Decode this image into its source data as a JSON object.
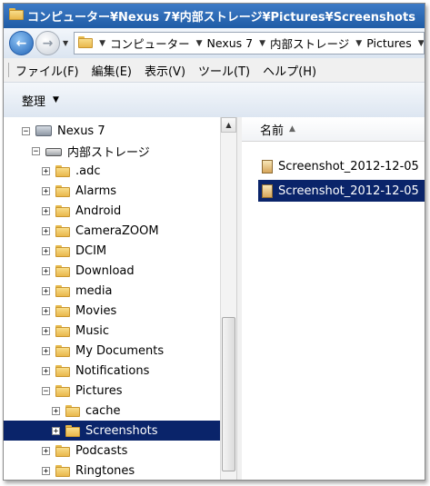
{
  "window": {
    "title": "コンピューター¥Nexus 7¥内部ストレージ¥Pictures¥Screenshots"
  },
  "address": {
    "segments": [
      "コンピューター",
      "Nexus 7",
      "内部ストレージ",
      "Pictures"
    ]
  },
  "menu": {
    "items": [
      "ファイル(F)",
      "編集(E)",
      "表示(V)",
      "ツール(T)",
      "ヘルプ(H)"
    ]
  },
  "toolbar": {
    "organize_label": "整理"
  },
  "tree": {
    "device_label": "Nexus 7",
    "storage_label": "内部ストレージ",
    "folders": [
      ".adc",
      "Alarms",
      "Android",
      "CameraZOOM",
      "DCIM",
      "Download",
      "media",
      "Movies",
      "Music",
      "My Documents",
      "Notifications"
    ],
    "pictures_label": "Pictures",
    "pictures_children": [
      "cache",
      "Screenshots"
    ],
    "after_folders": [
      "Podcasts",
      "Ringtones"
    ]
  },
  "file_list": {
    "column_name": "名前",
    "files": [
      "Screenshot_2012-12-05",
      "Screenshot_2012-12-05"
    ]
  },
  "colors": {
    "selection": "#0a246a",
    "title_bar": "#1f5ca6"
  }
}
